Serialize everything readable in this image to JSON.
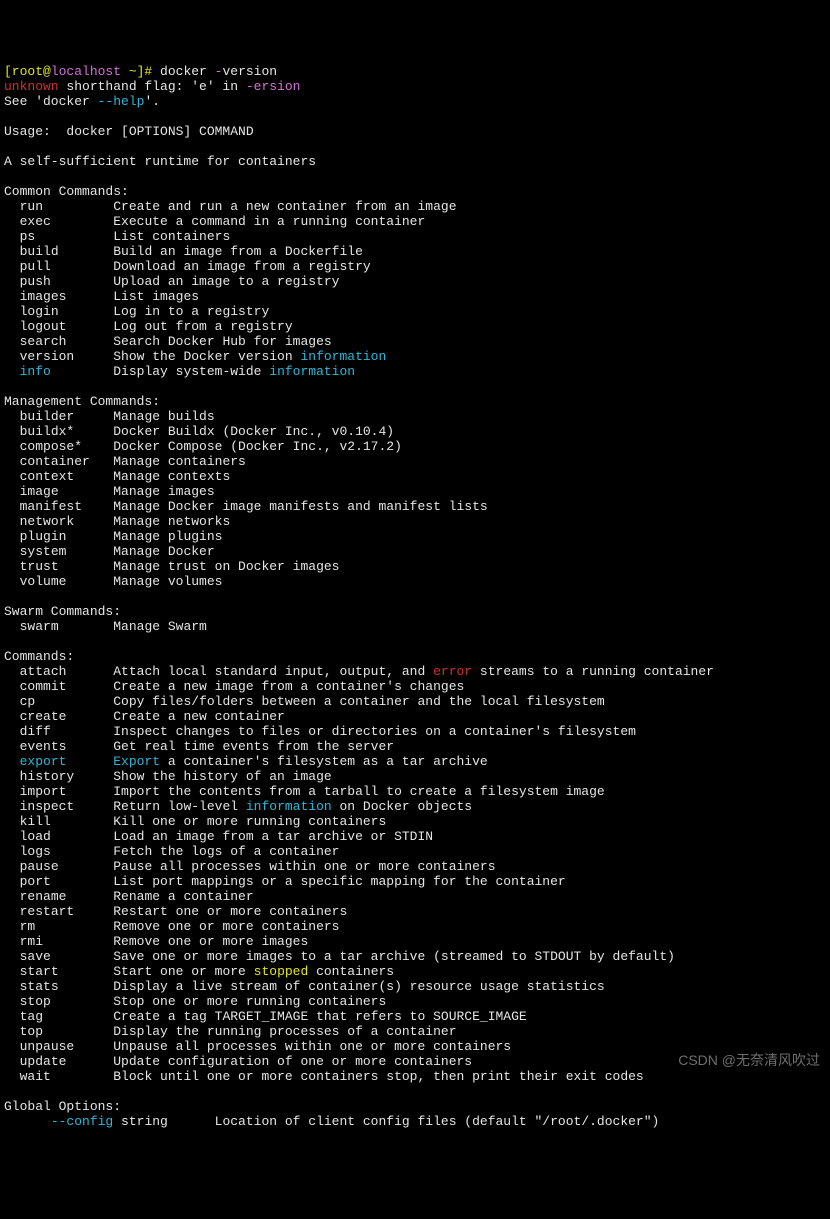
{
  "prompt": {
    "bracket_open": "[root@",
    "host": "localhost",
    "bracket_close": " ~]# ",
    "cmd_bin": "docker ",
    "cmd_flag": "-",
    "cmd_arg": "version"
  },
  "error": {
    "word": "unknown",
    "rest": " shorthand flag: 'e' in ",
    "flag": "-ersion"
  },
  "see_line": "See 'docker --help'.",
  "blank": "",
  "usage": "Usage:  docker [OPTIONS] COMMAND",
  "desc": "A self-sufficient runtime for containers",
  "sections": {
    "common": "Common Commands:",
    "management": "Management Commands:",
    "swarm": "Swarm Commands:",
    "commands": "Commands:",
    "global": "Global Options:"
  },
  "common": [
    {
      "cmd": "run",
      "desc": "Create and run a new container from an image"
    },
    {
      "cmd": "exec",
      "desc": "Execute a command in a running container"
    },
    {
      "cmd": "ps",
      "desc": "List containers"
    },
    {
      "cmd": "build",
      "desc": "Build an image from a Dockerfile"
    },
    {
      "cmd": "pull",
      "desc": "Download an image from a registry"
    },
    {
      "cmd": "push",
      "desc": "Upload an image to a registry"
    },
    {
      "cmd": "images",
      "desc": "List images"
    },
    {
      "cmd": "login",
      "desc": "Log in to a registry"
    },
    {
      "cmd": "logout",
      "desc": "Log out from a registry"
    },
    {
      "cmd": "search",
      "desc": "Search Docker Hub for images"
    },
    {
      "cmd": "version",
      "p1": "Show the Docker version ",
      "hl": "information",
      "p2": ""
    },
    {
      "cmd": "info",
      "cmd_hl": true,
      "p1": "Display system-wide ",
      "hl": "information",
      "p2": ""
    }
  ],
  "management": [
    {
      "cmd": "builder",
      "desc": "Manage builds"
    },
    {
      "cmd": "buildx*",
      "desc": "Docker Buildx (Docker Inc., v0.10.4)"
    },
    {
      "cmd": "compose*",
      "desc": "Docker Compose (Docker Inc., v2.17.2)"
    },
    {
      "cmd": "container",
      "desc": "Manage containers"
    },
    {
      "cmd": "context",
      "desc": "Manage contexts"
    },
    {
      "cmd": "image",
      "desc": "Manage images"
    },
    {
      "cmd": "manifest",
      "desc": "Manage Docker image manifests and manifest lists"
    },
    {
      "cmd": "network",
      "desc": "Manage networks"
    },
    {
      "cmd": "plugin",
      "desc": "Manage plugins"
    },
    {
      "cmd": "system",
      "desc": "Manage Docker"
    },
    {
      "cmd": "trust",
      "desc": "Manage trust on Docker images"
    },
    {
      "cmd": "volume",
      "desc": "Manage volumes"
    }
  ],
  "swarm": [
    {
      "cmd": "swarm",
      "desc": "Manage Swarm"
    }
  ],
  "commands": [
    {
      "cmd": "attach",
      "p1": "Attach local standard input, output, and ",
      "err": "error",
      "p2": " streams to a running container"
    },
    {
      "cmd": "commit",
      "desc": "Create a new image from a container's changes"
    },
    {
      "cmd": "cp",
      "desc": "Copy files/folders between a container and the local filesystem"
    },
    {
      "cmd": "create",
      "desc": "Create a new container"
    },
    {
      "cmd": "diff",
      "desc": "Inspect changes to files or directories on a container's filesystem"
    },
    {
      "cmd": "events",
      "desc": "Get real time events from the server"
    },
    {
      "cmd": "export",
      "cmd_hl": true,
      "p1": "",
      "hl": "Export",
      "p2": " a container's filesystem as a tar archive"
    },
    {
      "cmd": "history",
      "desc": "Show the history of an image"
    },
    {
      "cmd": "import",
      "desc": "Import the contents from a tarball to create a filesystem image"
    },
    {
      "cmd": "inspect",
      "p1": "Return low-level ",
      "hl": "information",
      "p2": " on Docker objects"
    },
    {
      "cmd": "kill",
      "desc": "Kill one or more running containers"
    },
    {
      "cmd": "load",
      "desc": "Load an image from a tar archive or STDIN"
    },
    {
      "cmd": "logs",
      "desc": "Fetch the logs of a container"
    },
    {
      "cmd": "pause",
      "desc": "Pause all processes within one or more containers"
    },
    {
      "cmd": "port",
      "desc": "List port mappings or a specific mapping for the container"
    },
    {
      "cmd": "rename",
      "desc": "Rename a container"
    },
    {
      "cmd": "restart",
      "desc": "Restart one or more containers"
    },
    {
      "cmd": "rm",
      "desc": "Remove one or more containers"
    },
    {
      "cmd": "rmi",
      "desc": "Remove one or more images"
    },
    {
      "cmd": "save",
      "desc": "Save one or more images to a tar archive (streamed to STDOUT by default)"
    },
    {
      "cmd": "start",
      "p1": "Start one or more ",
      "yl": "stopped",
      "p2": " containers"
    },
    {
      "cmd": "stats",
      "desc": "Display a live stream of container(s) resource usage statistics"
    },
    {
      "cmd": "stop",
      "desc": "Stop one or more running containers"
    },
    {
      "cmd": "tag",
      "desc": "Create a tag TARGET_IMAGE that refers to SOURCE_IMAGE"
    },
    {
      "cmd": "top",
      "desc": "Display the running processes of a container"
    },
    {
      "cmd": "unpause",
      "desc": "Unpause all processes within one or more containers"
    },
    {
      "cmd": "update",
      "desc": "Update configuration of one or more containers"
    },
    {
      "cmd": "wait",
      "desc": "Block until one or more containers stop, then print their exit codes"
    }
  ],
  "global_opt": {
    "flag": "--config",
    "type": " string",
    "desc": "Location of client config files (default \"/root/.docker\")"
  },
  "watermark": "CSDN @无奈清风吹过"
}
